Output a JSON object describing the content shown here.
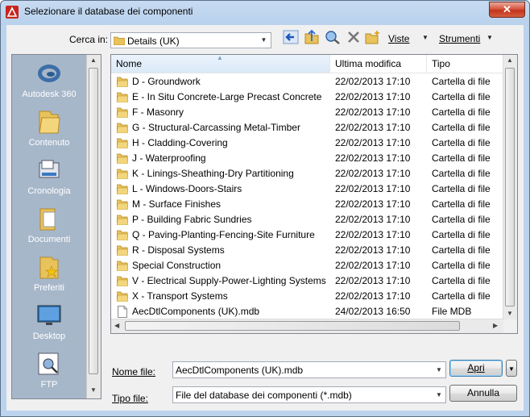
{
  "window": {
    "title": "Selezionare il database dei componenti",
    "close_glyph": "✕"
  },
  "toolbar": {
    "look_in_label": "Cerca in:",
    "look_in_value": "Details (UK)",
    "views_label": "Viste",
    "tools_label": "Strumenti"
  },
  "places": [
    {
      "label": "Autodesk 360",
      "icon": "autodesk360-icon"
    },
    {
      "label": "Contenuto",
      "icon": "folder-icon"
    },
    {
      "label": "Cronologia",
      "icon": "history-icon"
    },
    {
      "label": "Documenti",
      "icon": "documents-icon"
    },
    {
      "label": "Preferiti",
      "icon": "favorites-icon"
    },
    {
      "label": "Desktop",
      "icon": "desktop-icon"
    },
    {
      "label": "FTP",
      "icon": "ftp-icon"
    }
  ],
  "columns": {
    "name": "Nome",
    "modified": "Ultima modifica",
    "type": "Tipo"
  },
  "files": [
    {
      "name": "D - Groundwork",
      "modified": "22/02/2013 17:10",
      "type": "Cartella di file",
      "kind": "folder"
    },
    {
      "name": "E - In Situ Concrete-Large Precast Concrete",
      "modified": "22/02/2013 17:10",
      "type": "Cartella di file",
      "kind": "folder"
    },
    {
      "name": "F - Masonry",
      "modified": "22/02/2013 17:10",
      "type": "Cartella di file",
      "kind": "folder"
    },
    {
      "name": "G - Structural-Carcassing Metal-Timber",
      "modified": "22/02/2013 17:10",
      "type": "Cartella di file",
      "kind": "folder"
    },
    {
      "name": "H - Cladding-Covering",
      "modified": "22/02/2013 17:10",
      "type": "Cartella di file",
      "kind": "folder"
    },
    {
      "name": "J - Waterproofing",
      "modified": "22/02/2013 17:10",
      "type": "Cartella di file",
      "kind": "folder"
    },
    {
      "name": "K - Linings-Sheathing-Dry Partitioning",
      "modified": "22/02/2013 17:10",
      "type": "Cartella di file",
      "kind": "folder"
    },
    {
      "name": "L - Windows-Doors-Stairs",
      "modified": "22/02/2013 17:10",
      "type": "Cartella di file",
      "kind": "folder"
    },
    {
      "name": "M - Surface Finishes",
      "modified": "22/02/2013 17:10",
      "type": "Cartella di file",
      "kind": "folder"
    },
    {
      "name": "P - Building Fabric Sundries",
      "modified": "22/02/2013 17:10",
      "type": "Cartella di file",
      "kind": "folder"
    },
    {
      "name": "Q - Paving-Planting-Fencing-Site Furniture",
      "modified": "22/02/2013 17:10",
      "type": "Cartella di file",
      "kind": "folder"
    },
    {
      "name": "R - Disposal Systems",
      "modified": "22/02/2013 17:10",
      "type": "Cartella di file",
      "kind": "folder"
    },
    {
      "name": "Special Construction",
      "modified": "22/02/2013 17:10",
      "type": "Cartella di file",
      "kind": "folder"
    },
    {
      "name": "V - Electrical Supply-Power-Lighting Systems",
      "modified": "22/02/2013 17:10",
      "type": "Cartella di file",
      "kind": "folder"
    },
    {
      "name": "X - Transport Systems",
      "modified": "22/02/2013 17:10",
      "type": "Cartella di file",
      "kind": "folder"
    },
    {
      "name": "AecDtlComponents (UK).mdb",
      "modified": "24/02/2013 16:50",
      "type": "File MDB",
      "kind": "file"
    }
  ],
  "footer": {
    "filename_label": "Nome file:",
    "filename_value": "AecDtlComponents (UK).mdb",
    "filetype_label": "Tipo file:",
    "filetype_value": "File del database dei componenti (*.mdb)",
    "open_label": "Apri",
    "cancel_label": "Annulla"
  },
  "colors": {
    "title_bar": "#b9d1ec",
    "places_bg": "#a7b7ca",
    "folder": "#e8c25a",
    "close": "#c2351c"
  }
}
